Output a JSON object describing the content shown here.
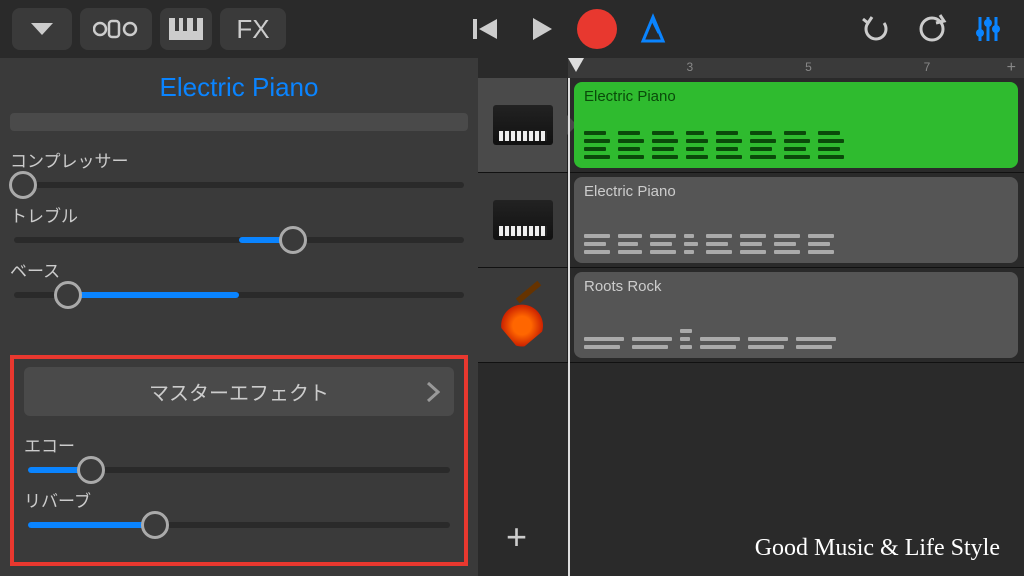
{
  "toolbar": {
    "fx_label": "FX"
  },
  "panel": {
    "title": "Electric Piano",
    "sliders": {
      "compressor": {
        "label": "コンプレッサー",
        "value": 0.02
      },
      "treble": {
        "label": "トレブル",
        "value": 0.62,
        "fill_start": 0.5
      },
      "bass": {
        "label": "ベース",
        "value": 0.12,
        "fill_end": 0.5
      }
    },
    "master": {
      "title": "マスターエフェクト",
      "echo": {
        "label": "エコー",
        "value": 0.15
      },
      "reverb": {
        "label": "リバーブ",
        "value": 0.3
      }
    }
  },
  "ruler": {
    "ticks": [
      "3",
      "5",
      "7"
    ]
  },
  "tracks": [
    {
      "name": "Electric Piano",
      "instrument": "piano",
      "selected": true,
      "region_style": "green"
    },
    {
      "name": "Electric Piano",
      "instrument": "piano",
      "selected": false,
      "region_style": "grey"
    },
    {
      "name": "Roots Rock",
      "instrument": "guitar",
      "selected": false,
      "region_style": "grey"
    }
  ],
  "watermark": "Good Music & Life Style"
}
